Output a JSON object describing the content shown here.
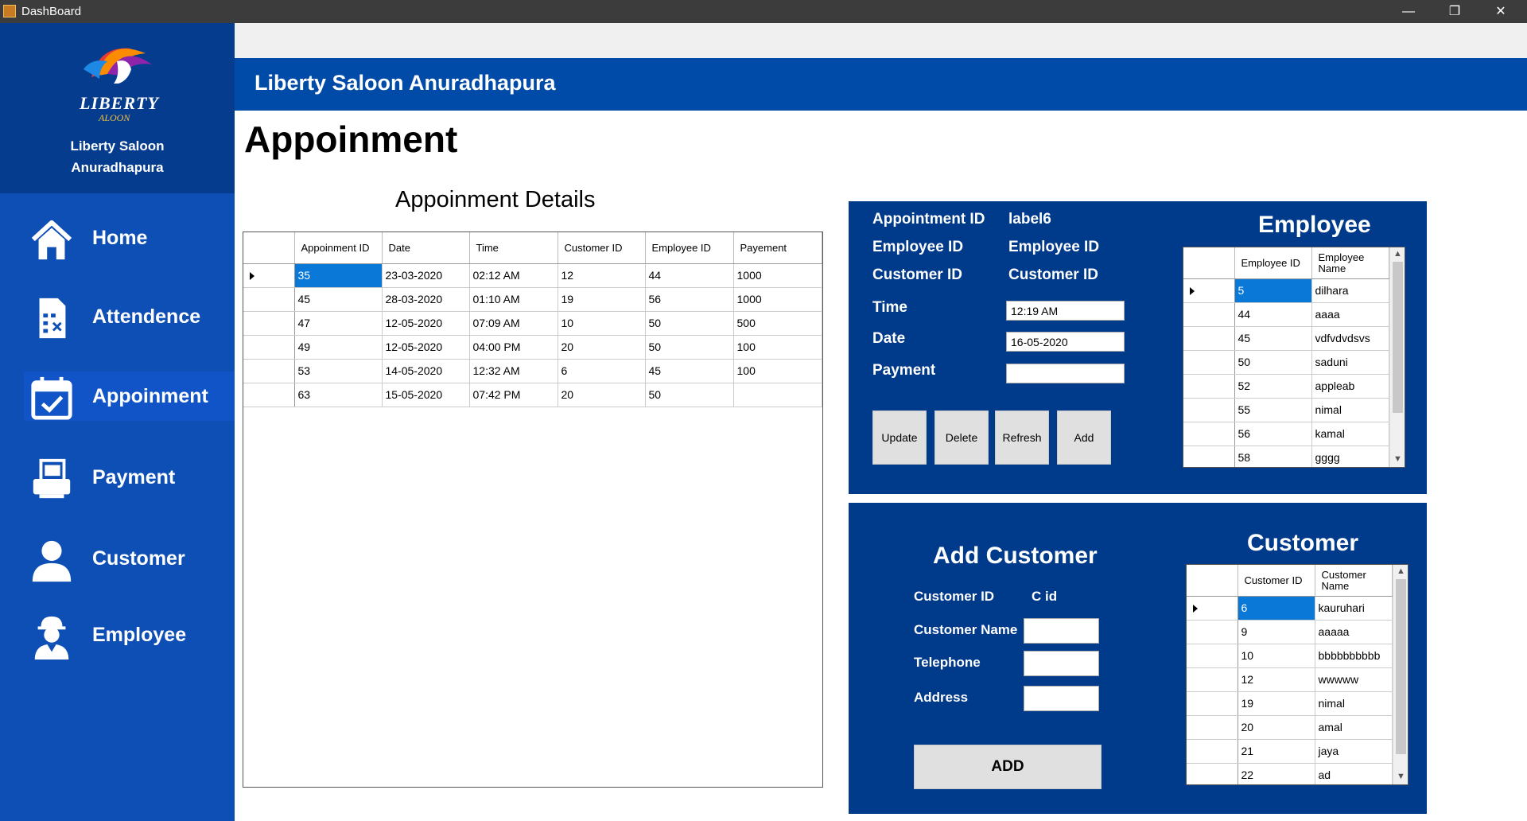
{
  "window": {
    "title": "DashBoard",
    "controls": {
      "minimize": "—",
      "maximize": "❐",
      "close": "✕"
    }
  },
  "sidebar": {
    "logo_text": "LIBERTY",
    "logo_sub": "ALOON",
    "brand_line1": "Liberty Saloon",
    "brand_line2": "Anuradhapura",
    "items": [
      {
        "label": "Home",
        "icon": "home-icon"
      },
      {
        "label": "Attendence",
        "icon": "attendance-sheet-icon"
      },
      {
        "label": "Appoinment",
        "icon": "calendar-check-icon",
        "active": true
      },
      {
        "label": "Payment",
        "icon": "payment-terminal-icon"
      },
      {
        "label": "Customer",
        "icon": "user-icon"
      },
      {
        "label": "Employee",
        "icon": "worker-icon"
      }
    ]
  },
  "header": {
    "title": "Liberty Saloon Anuradhapura"
  },
  "page_title": "Appoinment",
  "details": {
    "title": "Appoinment Details",
    "columns": [
      "Appoinment ID",
      "Date",
      "Time",
      "Customer ID",
      "Employee ID",
      "Payement"
    ],
    "rows": [
      [
        "35",
        "23-03-2020",
        "02:12 AM",
        "12",
        "44",
        "1000"
      ],
      [
        "45",
        "28-03-2020",
        "01:10 AM",
        "19",
        "56",
        "1000"
      ],
      [
        "47",
        "12-05-2020",
        "07:09 AM",
        "10",
        "50",
        "500"
      ],
      [
        "49",
        "12-05-2020",
        "04:00 PM",
        "20",
        "50",
        "100"
      ],
      [
        "53",
        "14-05-2020",
        "12:32 AM",
        "6",
        "45",
        "100"
      ],
      [
        "63",
        "15-05-2020",
        "07:42 PM",
        "20",
        "50",
        ""
      ]
    ]
  },
  "form": {
    "appointment_id_label": "Appointment ID",
    "appointment_id_value": "label6",
    "employee_id_label": "Employee ID",
    "employee_id_value": "Employee ID",
    "customer_id_label": "Customer ID",
    "customer_id_value": "Customer ID",
    "time_label": "Time",
    "time_value": "12:19 AM",
    "date_label": "Date",
    "date_value": "16-05-2020",
    "payment_label": "Payment",
    "payment_value": "",
    "buttons": {
      "update": "Update",
      "delete": "Delete",
      "refresh": "Refresh",
      "add": "Add"
    }
  },
  "employee": {
    "title": "Employee",
    "columns": [
      "Employee ID",
      "Employee Name"
    ],
    "rows": [
      [
        "5",
        "dilhara"
      ],
      [
        "44",
        "aaaa"
      ],
      [
        "45",
        "vdfvdvdsvs"
      ],
      [
        "50",
        "saduni"
      ],
      [
        "52",
        "appleab"
      ],
      [
        "55",
        "nimal"
      ],
      [
        "56",
        "kamal"
      ],
      [
        "58",
        "gggg"
      ]
    ]
  },
  "add_customer": {
    "title": "Add Customer",
    "customer_id_label": "Customer ID",
    "customer_id_value": "C id",
    "name_label": "Customer Name",
    "telephone_label": "Telephone",
    "address_label": "Address",
    "add_button": "ADD"
  },
  "customer": {
    "title": "Customer",
    "columns": [
      "Customer ID",
      "Customer Name"
    ],
    "rows": [
      [
        "6",
        "kauruhari"
      ],
      [
        "9",
        "aaaaa"
      ],
      [
        "10",
        "bbbbbbbbbb"
      ],
      [
        "12",
        "wwwww"
      ],
      [
        "19",
        "nimal"
      ],
      [
        "20",
        "amal"
      ],
      [
        "21",
        "jaya"
      ],
      [
        "22",
        "ad"
      ]
    ]
  }
}
